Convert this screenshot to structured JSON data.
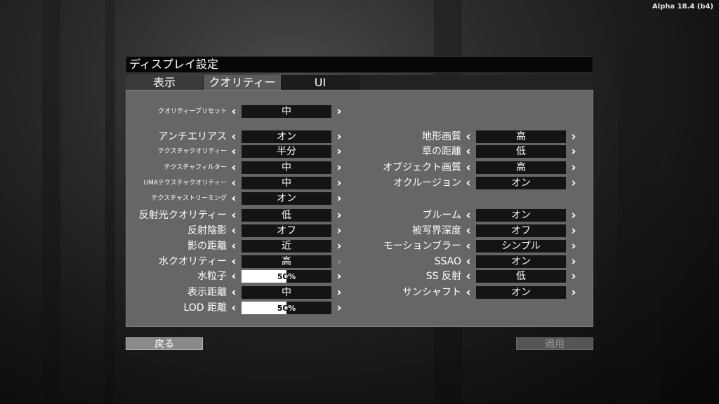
{
  "version": "Alpha 18.4 (b4)",
  "window_title": "ディスプレイ設定",
  "tabs": [
    "表示",
    "クオリティー",
    "UI"
  ],
  "left_settings": [
    {
      "label": "クオリティープリセット",
      "value": "中",
      "small": true
    },
    {
      "label": "アンチエリアス",
      "value": "オン"
    },
    {
      "label": "テクスチャクオリティー",
      "value": "半分",
      "small": true
    },
    {
      "label": "テクスチャフィルター",
      "value": "中",
      "small": true
    },
    {
      "label": "UMAテクスチャクオリティー",
      "value": "中",
      "small": true
    },
    {
      "label": "テクスチャストリーミング",
      "value": "オン",
      "small": true
    },
    {
      "label": "反射光クオリティー",
      "value": "低"
    },
    {
      "label": "反射陰影",
      "value": "オフ"
    },
    {
      "label": "影の距離",
      "value": "近"
    },
    {
      "label": "水クオリティー",
      "value": "高",
      "right_arrow_disabled": true
    },
    {
      "label": "水粒子",
      "value": "50%",
      "slider": 0.5
    },
    {
      "label": "表示距離",
      "value": "中"
    },
    {
      "label": "LOD 距離",
      "value": "50%",
      "slider": 0.5
    }
  ],
  "right_settings": [
    {
      "label": "地形画質",
      "value": "高"
    },
    {
      "label": "草の距離",
      "value": "低"
    },
    {
      "label": "オブジェクト画質",
      "value": "高"
    },
    {
      "label": "オクルージョン",
      "value": "オン"
    },
    {
      "label": "ブルーム",
      "value": "オン"
    },
    {
      "label": "被写界深度",
      "value": "オフ"
    },
    {
      "label": "モーションブラー",
      "value": "シンプル"
    },
    {
      "label": "SSAO",
      "value": "オン"
    },
    {
      "label": "SS 反射",
      "value": "低"
    },
    {
      "label": "サンシャフト",
      "value": "オン"
    }
  ],
  "buttons": {
    "back": "戻る",
    "apply": "適用"
  },
  "icons": {
    "left": "chevron-left-icon",
    "right": "chevron-right-icon"
  }
}
